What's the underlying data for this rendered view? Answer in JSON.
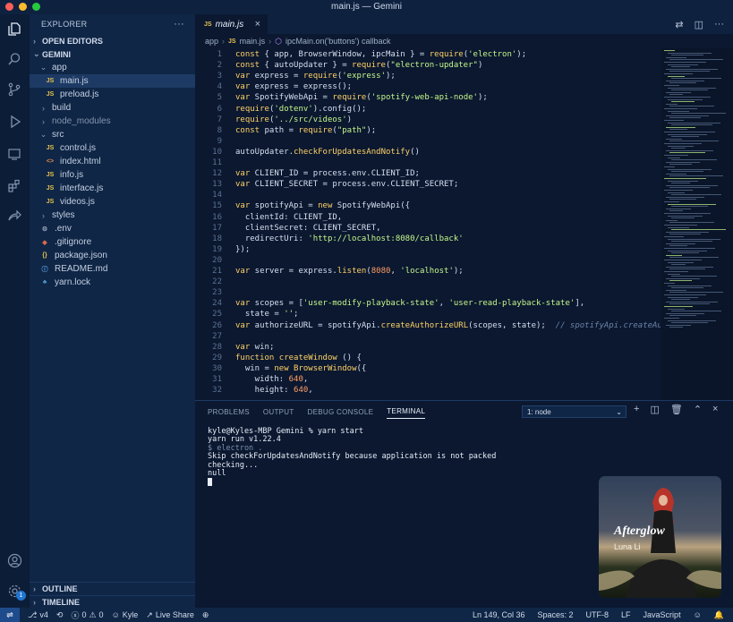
{
  "window": {
    "title": "main.js — Gemini"
  },
  "colors": {
    "close": "#ff5f57",
    "minimize": "#febc2e",
    "maximize": "#28c840",
    "accent": "#1e4b8c"
  },
  "activity": {
    "items": [
      "explorer-icon",
      "search-icon",
      "source-control-icon",
      "run-debug-icon",
      "remote-explorer-icon",
      "extensions-icon",
      "live-share-icon"
    ],
    "bottom": [
      "account-icon",
      "settings-icon"
    ],
    "badge": "1"
  },
  "sidebar": {
    "title": "EXPLORER",
    "more": "···",
    "open_editors": "OPEN EDITORS",
    "root": "GEMINI",
    "tree": [
      {
        "label": "app",
        "indent": 1,
        "kind": "folder-open"
      },
      {
        "label": "main.js",
        "indent": 2,
        "kind": "js",
        "icon": "JS",
        "selected": true
      },
      {
        "label": "preload.js",
        "indent": 2,
        "kind": "js",
        "icon": "JS"
      },
      {
        "label": "build",
        "indent": 1,
        "kind": "folder"
      },
      {
        "label": "node_modules",
        "indent": 1,
        "kind": "folder",
        "dim": true
      },
      {
        "label": "src",
        "indent": 1,
        "kind": "folder-open"
      },
      {
        "label": "control.js",
        "indent": 2,
        "kind": "js",
        "icon": "JS"
      },
      {
        "label": "index.html",
        "indent": 2,
        "kind": "html",
        "icon": "<>"
      },
      {
        "label": "info.js",
        "indent": 2,
        "kind": "js",
        "icon": "JS"
      },
      {
        "label": "interface.js",
        "indent": 2,
        "kind": "js",
        "icon": "JS"
      },
      {
        "label": "videos.js",
        "indent": 2,
        "kind": "js",
        "icon": "JS"
      },
      {
        "label": "styles",
        "indent": 1,
        "kind": "folder"
      },
      {
        "label": ".env",
        "indent": 1,
        "kind": "env",
        "icon": "⚙"
      },
      {
        "label": ".gitignore",
        "indent": 1,
        "kind": "git",
        "icon": "◆"
      },
      {
        "label": "package.json",
        "indent": 1,
        "kind": "json",
        "icon": "{}"
      },
      {
        "label": "README.md",
        "indent": 1,
        "kind": "md",
        "icon": "ⓘ"
      },
      {
        "label": "yarn.lock",
        "indent": 1,
        "kind": "yarn",
        "icon": "♣"
      }
    ],
    "outline": "OUTLINE",
    "timeline": "TIMELINE"
  },
  "editor": {
    "tab_icon": "JS",
    "tab_label": "main.js",
    "tab_close": "×",
    "breadcrumb": [
      "app",
      "main.js",
      "ipcMain.on('buttons') callback"
    ],
    "breadcrumb_icon": "JS",
    "lines": [
      [
        [
          "kw",
          "const"
        ],
        [
          "p",
          " { app, BrowserWindow, ipcMain } = "
        ],
        [
          "kw",
          "require"
        ],
        [
          "p",
          "("
        ],
        [
          "s",
          "'electron'"
        ],
        [
          "p",
          ");"
        ]
      ],
      [
        [
          "kw",
          "const"
        ],
        [
          "p",
          " { autoUpdater } = "
        ],
        [
          "kw",
          "require"
        ],
        [
          "p",
          "("
        ],
        [
          "s",
          "\"electron-updater\""
        ],
        [
          "p",
          ")"
        ]
      ],
      [
        [
          "kw",
          "var"
        ],
        [
          "p",
          " express = "
        ],
        [
          "kw",
          "require"
        ],
        [
          "p",
          "("
        ],
        [
          "s",
          "'express'"
        ],
        [
          "p",
          ");"
        ]
      ],
      [
        [
          "kw",
          "var"
        ],
        [
          "p",
          " express = express();"
        ]
      ],
      [
        [
          "kw",
          "var"
        ],
        [
          "p",
          " SpotifyWebApi = "
        ],
        [
          "kw",
          "require"
        ],
        [
          "p",
          "("
        ],
        [
          "s",
          "'spotify-web-api-node'"
        ],
        [
          "p",
          ");"
        ]
      ],
      [
        [
          "kw",
          "require"
        ],
        [
          "p",
          "("
        ],
        [
          "s",
          "'dotenv'"
        ],
        [
          "p",
          ").config();"
        ]
      ],
      [
        [
          "kw",
          "require"
        ],
        [
          "p",
          "("
        ],
        [
          "s",
          "'../src/videos'"
        ],
        [
          "p",
          ")"
        ]
      ],
      [
        [
          "kw",
          "const"
        ],
        [
          "p",
          " path = "
        ],
        [
          "kw",
          "require"
        ],
        [
          "p",
          "("
        ],
        [
          "s",
          "\"path\""
        ],
        [
          "p",
          ");"
        ]
      ],
      [],
      [
        [
          "p",
          "autoUpdater."
        ],
        [
          "kw",
          "checkForUpdatesAndNotify"
        ],
        [
          "p",
          "()"
        ]
      ],
      [],
      [
        [
          "kw",
          "var"
        ],
        [
          "p",
          " CLIENT_ID = process.env.CLIENT_ID;"
        ]
      ],
      [
        [
          "kw",
          "var"
        ],
        [
          "p",
          " CLIENT_SECRET = process.env.CLIENT_SECRET;"
        ]
      ],
      [],
      [
        [
          "kw",
          "var"
        ],
        [
          "p",
          " spotifyApi = "
        ],
        [
          "kw",
          "new"
        ],
        [
          "p",
          " SpotifyWebApi({"
        ]
      ],
      [
        [
          "p",
          "  clientId: CLIENT_ID,"
        ]
      ],
      [
        [
          "p",
          "  clientSecret: CLIENT_SECRET,"
        ]
      ],
      [
        [
          "p",
          "  redirectUri: "
        ],
        [
          "s",
          "'http://localhost:8080/callback'"
        ]
      ],
      [
        [
          "p",
          "});"
        ]
      ],
      [],
      [
        [
          "kw",
          "var"
        ],
        [
          "p",
          " server = express."
        ],
        [
          "kw",
          "listen"
        ],
        [
          "p",
          "("
        ],
        [
          "n",
          "8080"
        ],
        [
          "p",
          ", "
        ],
        [
          "s",
          "'localhost'"
        ],
        [
          "p",
          ");"
        ]
      ],
      [],
      [],
      [
        [
          "kw",
          "var"
        ],
        [
          "p",
          " scopes = ["
        ],
        [
          "s",
          "'user-modify-playback-state'"
        ],
        [
          "p",
          ", "
        ],
        [
          "s",
          "'user-read-playback-state'"
        ],
        [
          "p",
          "],"
        ]
      ],
      [
        [
          "p",
          "  state = "
        ],
        [
          "s",
          "''"
        ],
        [
          "p",
          ";"
        ]
      ],
      [
        [
          "kw",
          "var"
        ],
        [
          "p",
          " authorizeURL = spotifyApi."
        ],
        [
          "kw",
          "createAuthorizeURL"
        ],
        [
          "p",
          "(scopes, state);  "
        ],
        [
          "c",
          "// spotifyApi.createAuthorizeUR"
        ]
      ],
      [],
      [
        [
          "kw",
          "var"
        ],
        [
          "p",
          " win;"
        ]
      ],
      [
        [
          "kw",
          "function"
        ],
        [
          "p",
          " "
        ],
        [
          "kw",
          "createWindow"
        ],
        [
          "p",
          " () {"
        ]
      ],
      [
        [
          "p",
          "  win = "
        ],
        [
          "kw",
          "new"
        ],
        [
          "p",
          " "
        ],
        [
          "kw",
          "BrowserWindow"
        ],
        [
          "p",
          "({"
        ]
      ],
      [
        [
          "p",
          "    width: "
        ],
        [
          "n",
          "640"
        ],
        [
          "p",
          ","
        ]
      ],
      [
        [
          "p",
          "    height: "
        ],
        [
          "n",
          "640"
        ],
        [
          "p",
          ","
        ]
      ]
    ]
  },
  "panel": {
    "tabs": [
      "PROBLEMS",
      "OUTPUT",
      "DEBUG CONSOLE",
      "TERMINAL"
    ],
    "active_tab": "TERMINAL",
    "terminal_select": "1: node",
    "terminal": [
      {
        "text": "kyle@Kyles-MBP Gemini % yarn start",
        "dim": false
      },
      {
        "text": "yarn run v1.22.4",
        "dim": false
      },
      {
        "text": "$ electron .",
        "dim": true
      },
      {
        "text": "Skip checkForUpdatesAndNotify because application is not packed",
        "dim": false
      },
      {
        "text": "checking...",
        "dim": false
      },
      {
        "text": "null",
        "dim": false
      }
    ]
  },
  "now_playing": {
    "title": "Afterglow",
    "artist": "Luna Li"
  },
  "status": {
    "branch": "v4",
    "errors": "0",
    "warnings": "0",
    "user": "Kyle",
    "live_share": "Live Share",
    "position": "Ln 149, Col 36",
    "spaces": "Spaces: 2",
    "encoding": "UTF-8",
    "eol": "LF",
    "language": "JavaScript"
  }
}
